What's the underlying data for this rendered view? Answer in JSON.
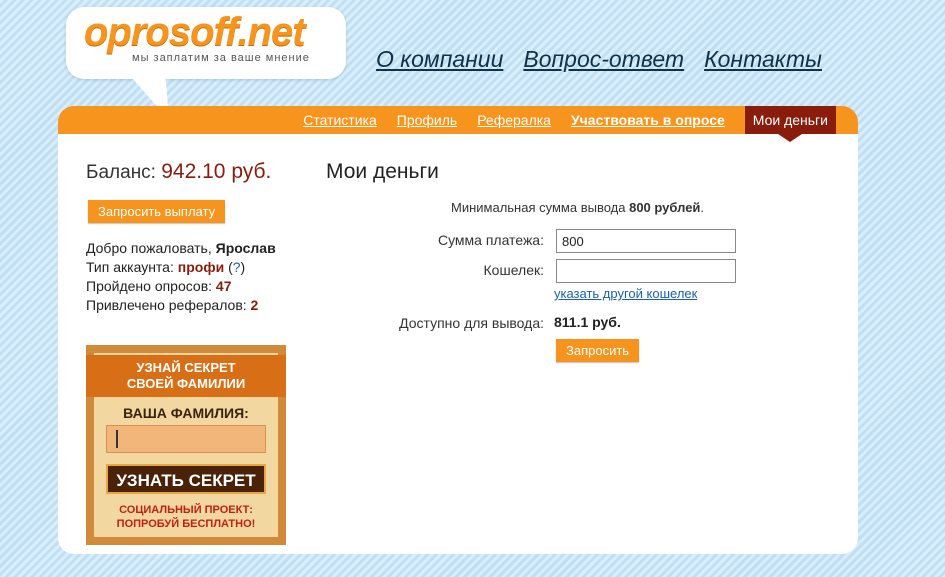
{
  "logo": {
    "name": "oprosoff.net",
    "tagline": "мы заплатим за ваше мнение"
  },
  "topnav": [
    "О компании",
    "Вопрос-ответ",
    "Контакты"
  ],
  "mainnav": {
    "items": [
      "Статистика",
      "Профиль",
      "Рефералка",
      "Участвовать в опросе"
    ],
    "active": "Мои деньги"
  },
  "sidebar": {
    "balance_label": "Баланс:",
    "balance_value": "942.10 руб.",
    "request_button": "Запросить выплату",
    "welcome_label": "Добро пожаловать,",
    "welcome_name": "Ярослав",
    "account_type_label": "Тип аккаунта:",
    "account_type_value": "профи",
    "account_help_link": "?",
    "surveys_label": "Пройдено опросов:",
    "surveys_value": "47",
    "referrals_label": "Привлечено рефералов:",
    "referrals_value": "2"
  },
  "ad": {
    "ribbon_line1": "УЗНАЙ СЕКРЕТ",
    "ribbon_line2": "СВОЕЙ ФАМИЛИИ",
    "label": "ВАША ФАМИЛИЯ:",
    "button": "УЗНАТЬ СЕКРЕТ",
    "foot_line1": "СОЦИАЛЬНЫЙ ПРОЕКТ:",
    "foot_line2": "ПОПРОБУЙ БЕСПЛАТНО!"
  },
  "content": {
    "title": "Мои деньги",
    "min_note_prefix": "Минимальная сумма вывода",
    "min_note_value": "800 рублей",
    "min_note_suffix": ".",
    "amount_label": "Сумма платежа:",
    "amount_value": "800",
    "wallet_label": "Кошелек:",
    "wallet_value": "",
    "other_wallet_link": "указать другой кошелек",
    "available_label": "Доступно для вывода:",
    "available_value": "811.1 руб.",
    "submit_button": "Запросить"
  },
  "colors": {
    "accent": "#f7941d",
    "active_tab": "#8a1c0c",
    "balance": "#8a1c0c",
    "link": "#1a5fb4"
  }
}
